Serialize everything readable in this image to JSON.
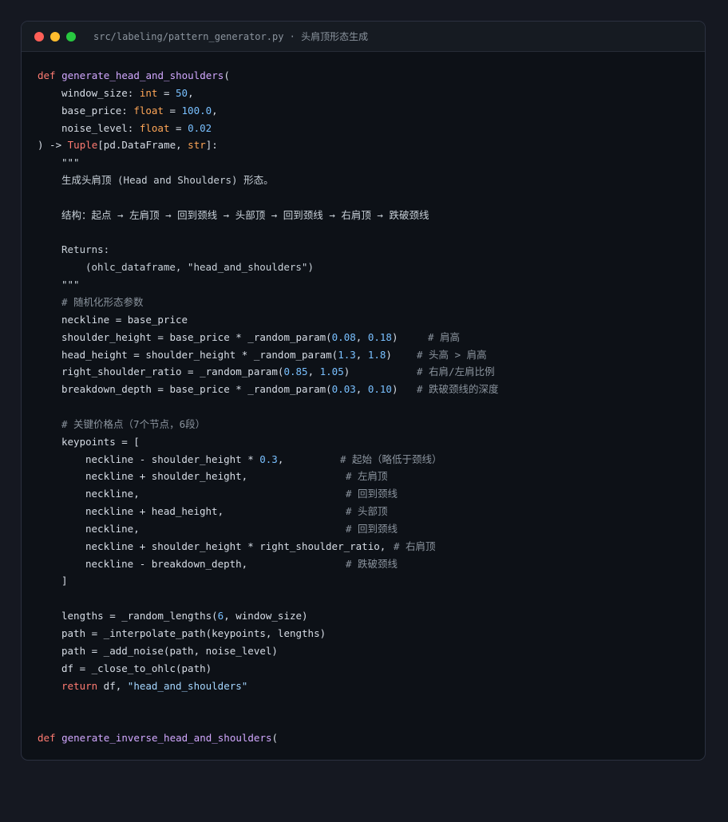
{
  "window": {
    "title": "src/labeling/pattern_generator.py · 头肩顶形态生成"
  },
  "code": {
    "l1_def": "def",
    "l1_fn": "generate_head_and_shoulders",
    "l1_paren": "(",
    "l2_name": "window_size: ",
    "l2_type": "int",
    "l2_eq": " = ",
    "l2_val": "50",
    "l2_end": ",",
    "l3_name": "base_price: ",
    "l3_type": "float",
    "l3_eq": " = ",
    "l3_val": "100.0",
    "l3_end": ",",
    "l4_name": "noise_level: ",
    "l4_type": "float",
    "l4_eq": " = ",
    "l4_val": "0.02",
    "l5_a": ") -> ",
    "l5_tuple": "Tuple",
    "l5_b": "[pd.DataFrame, ",
    "l5_str": "str",
    "l5_c": "]:",
    "l6_doc": "\"\"\"",
    "l7_doc": "生成头肩顶 (Head and Shoulders) 形态。",
    "l9_doc": "结构：起点 → 左肩顶 → 回到颈线 → 头部顶 → 回到颈线 → 右肩顶 → 跌破颈线",
    "l11_doc": "Returns:",
    "l12_doc": "(ohlc_dataframe, \"head_and_shoulders\")",
    "l13_doc": "\"\"\"",
    "l14_cm": "# 随机化形态参数",
    "l15": "neckline = base_price",
    "l16_a": "shoulder_height = base_price * _random_param(",
    "l16_n1": "0.08",
    "l16_b": ", ",
    "l16_n2": "0.18",
    "l16_c": ")",
    "l16_cm": "# 肩高",
    "l17_a": "head_height = shoulder_height * _random_param(",
    "l17_n1": "1.3",
    "l17_b": ", ",
    "l17_n2": "1.8",
    "l17_c": ")",
    "l17_cm": "# 头高 > 肩高",
    "l18_a": "right_shoulder_ratio = _random_param(",
    "l18_n1": "0.85",
    "l18_b": ", ",
    "l18_n2": "1.05",
    "l18_c": ")",
    "l18_cm": "# 右肩/左肩比例",
    "l19_a": "breakdown_depth = base_price * _random_param(",
    "l19_n1": "0.03",
    "l19_b": ", ",
    "l19_n2": "0.10",
    "l19_c": ")",
    "l19_cm": "# 跌破颈线的深度",
    "l21_cm": "# 关键价格点（7个节点，6段）",
    "l22": "keypoints = [",
    "l23_a": "neckline - shoulder_height * ",
    "l23_n": "0.3",
    "l23_b": ",",
    "l23_cm": "# 起始（略低于颈线）",
    "l24": "neckline + shoulder_height,",
    "l24_cm": "# 左肩顶",
    "l25": "neckline,",
    "l25_cm": "# 回到颈线",
    "l26": "neckline + head_height,",
    "l26_cm": "# 头部顶",
    "l27": "neckline,",
    "l27_cm": "# 回到颈线",
    "l28": "neckline + shoulder_height * right_shoulder_ratio,",
    "l28_cm": "# 右肩顶",
    "l29": "neckline - breakdown_depth,",
    "l29_cm": "# 跌破颈线",
    "l30": "]",
    "l32_a": "lengths = _random_lengths(",
    "l32_n": "6",
    "l32_b": ", window_size)",
    "l33": "path = _interpolate_path(keypoints, lengths)",
    "l34": "path = _add_noise(path, noise_level)",
    "l35": "df = _close_to_ohlc(path)",
    "l36_kw": "return",
    "l36_a": " df, ",
    "l36_str": "\"head_and_shoulders\"",
    "l39_def": "def",
    "l39_fn": "generate_inverse_head_and_shoulders",
    "l39_paren": "("
  }
}
